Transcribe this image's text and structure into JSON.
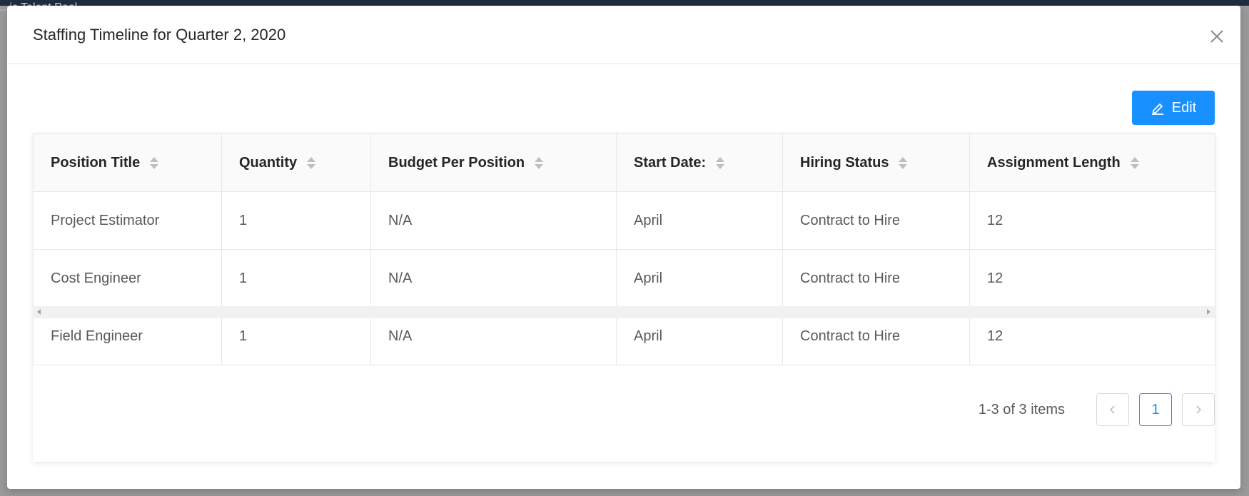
{
  "background": {
    "title_fragment": "...ic Talent Pool"
  },
  "modal": {
    "title": "Staffing Timeline for Quarter 2, 2020",
    "edit_label": "Edit"
  },
  "table": {
    "columns": [
      "Position Title",
      "Quantity",
      "Budget Per Position",
      "Start Date:",
      "Hiring Status",
      "Assignment Length"
    ],
    "rows": [
      [
        "Project Estimator",
        "1",
        "N/A",
        "April",
        "Contract to Hire",
        "12"
      ],
      [
        "Cost Engineer",
        "1",
        "N/A",
        "April",
        "Contract to Hire",
        "12"
      ],
      [
        "Field Engineer",
        "1",
        "N/A",
        "April",
        "Contract to Hire",
        "12"
      ]
    ]
  },
  "pagination": {
    "total_text": "1-3 of 3 items",
    "current_page": "1"
  },
  "colors": {
    "primary": "#1890ff",
    "header_bg": "#fafafa",
    "border": "#e8e8e8"
  }
}
